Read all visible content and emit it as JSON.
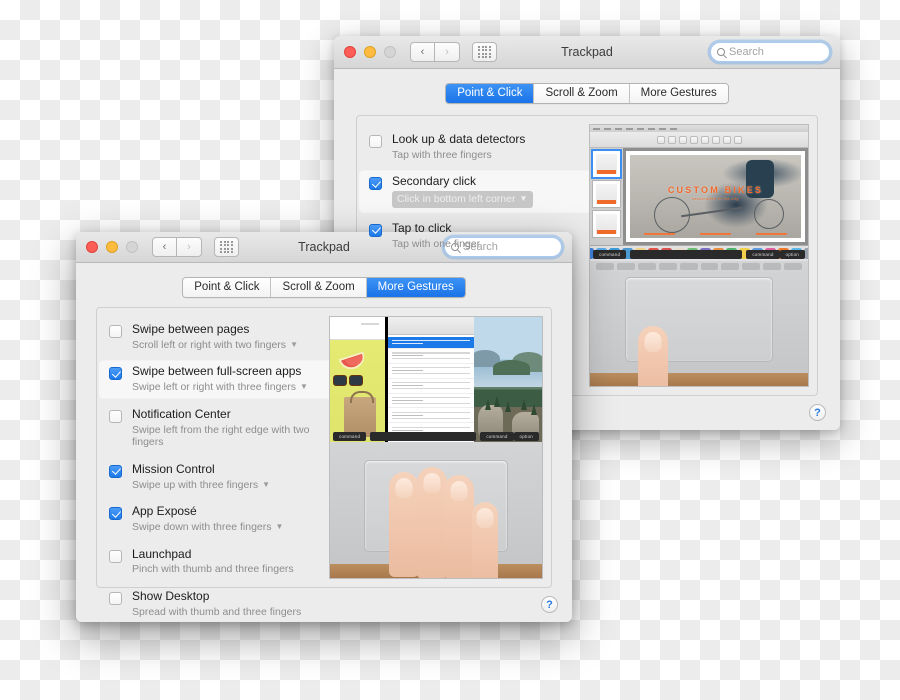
{
  "windows": {
    "back": {
      "title": "Trackpad",
      "search": {
        "placeholder": "Search",
        "value": ""
      },
      "nav": {
        "back_label": "‹",
        "forward_label": "›"
      },
      "tabs": [
        {
          "label": "Point & Click",
          "active": true
        },
        {
          "label": "Scroll & Zoom",
          "active": false
        },
        {
          "label": "More Gestures",
          "active": false
        }
      ],
      "options": [
        {
          "title": "Look up & data detectors",
          "subtitle": "Tap with three fingers",
          "checked": false,
          "popup": false,
          "selected": false
        },
        {
          "title": "Secondary click",
          "subtitle": "Click in bottom left corner",
          "checked": true,
          "popup": true,
          "selected": true
        },
        {
          "title": "Tap to click",
          "subtitle": "Tap with one finger",
          "checked": true,
          "popup": false,
          "selected": false
        }
      ],
      "preview": {
        "app_title": "CUSTOM",
        "app_title2": "BIKES",
        "app_tagline": "handcrafted in the city",
        "keys": {
          "left": "command",
          "right_1": "command",
          "right_2": "option"
        }
      },
      "help_label": "?"
    },
    "front": {
      "title": "Trackpad",
      "search": {
        "placeholder": "Search",
        "value": ""
      },
      "nav": {
        "back_label": "‹",
        "forward_label": "›"
      },
      "tabs": [
        {
          "label": "Point & Click",
          "active": false
        },
        {
          "label": "Scroll & Zoom",
          "active": false
        },
        {
          "label": "More Gestures",
          "active": true
        }
      ],
      "options": [
        {
          "title": "Swipe between pages",
          "subtitle": "Scroll left or right with two fingers",
          "checked": false,
          "chevron": true,
          "selected": false
        },
        {
          "title": "Swipe between full-screen apps",
          "subtitle": "Swipe left or right with three fingers",
          "checked": true,
          "chevron": true,
          "selected": true
        },
        {
          "title": "Notification Center",
          "subtitle": "Swipe left from the right edge with two fingers",
          "checked": false,
          "chevron": false,
          "selected": false
        },
        {
          "title": "Mission Control",
          "subtitle": "Swipe up with three fingers",
          "checked": true,
          "chevron": true,
          "selected": false
        },
        {
          "title": "App Exposé",
          "subtitle": "Swipe down with three fingers",
          "checked": true,
          "chevron": true,
          "selected": false
        },
        {
          "title": "Launchpad",
          "subtitle": "Pinch with thumb and three fingers",
          "checked": false,
          "chevron": false,
          "selected": false
        },
        {
          "title": "Show Desktop",
          "subtitle": "Spread with thumb and three fingers",
          "checked": false,
          "chevron": false,
          "selected": false
        }
      ],
      "preview": {
        "keys": {
          "left": "command",
          "right_1": "command",
          "right_2": "option"
        }
      },
      "help_label": "?"
    }
  },
  "colors": {
    "accent_blue": "#1c7ae8",
    "window_bg": "#ececec",
    "selected_row": "#f7f7f7",
    "checkbox_on": "#2b82ec",
    "help_blue": "#2a7ae0",
    "orange_title": "#f2692a"
  }
}
